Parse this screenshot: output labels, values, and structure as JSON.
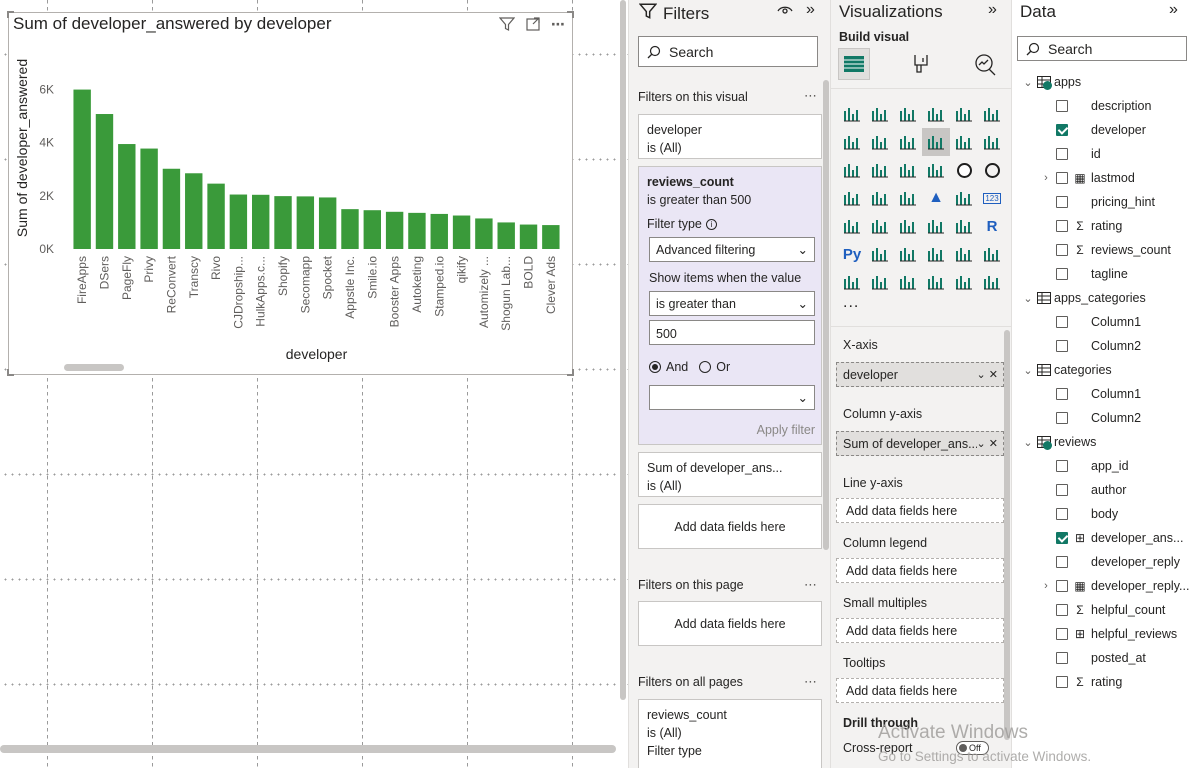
{
  "chart_data": {
    "type": "bar",
    "title": "Sum of developer_answered by developer",
    "xlabel": "developer",
    "ylabel": "Sum of developer_answered",
    "categories": [
      "FireApps",
      "DSers",
      "PageFly",
      "Privy",
      "ReConvert",
      "Transcy",
      "Rivo",
      "CJDropship...",
      "HulkApps.c...",
      "Shopify",
      "Secomapp",
      "Spocket",
      "Appstle Inc.",
      "Smile.io",
      "Booster Apps",
      "Autoketing",
      "Stamped.io",
      "qikify",
      "Automizely ...",
      "Shogun Lab...",
      "BOLD",
      "Clever Ads"
    ],
    "values": [
      6000,
      5080,
      3950,
      3780,
      3020,
      2850,
      2460,
      2050,
      2040,
      1990,
      1980,
      1940,
      1500,
      1460,
      1400,
      1360,
      1320,
      1260,
      1150,
      1000,
      920,
      900
    ],
    "yticks": [
      "0K",
      "2K",
      "4K",
      "6K"
    ],
    "ylim": [
      0,
      7000
    ],
    "color": "#3a9a3a"
  },
  "filters": {
    "title": "Filters",
    "search_placeholder": "Search",
    "on_visual": "Filters on this visual",
    "on_page": "Filters on this page",
    "on_all_pages": "Filters on all pages",
    "card_developer": {
      "name": "developer",
      "state": "is (All)"
    },
    "card_reviews": {
      "name": "reviews_count",
      "state": "is greater than 500",
      "filter_type_label": "Filter type",
      "filter_type_value": "Advanced filtering",
      "show_items_label": "Show items when the value",
      "condition": "is greater than",
      "value": "500",
      "and_label": "And",
      "or_label": "Or",
      "apply": "Apply filter"
    },
    "card_sum": {
      "name": "Sum of developer_ans...",
      "state": "is (All)"
    },
    "add_fields": "Add data fields here",
    "card_all_pages": {
      "name": "reviews_count",
      "state": "is (All)",
      "partial": "Filter type"
    }
  },
  "viz": {
    "title": "Visualizations",
    "build_visual": "Build visual",
    "more": "...",
    "wells": [
      {
        "label": "X-axis",
        "value": "developer"
      },
      {
        "label": "Column y-axis",
        "value": "Sum of developer_ans..."
      },
      {
        "label": "Line y-axis",
        "value": "Add data fields here"
      },
      {
        "label": "Column legend",
        "value": "Add data fields here"
      },
      {
        "label": "Small multiples",
        "value": "Add data fields here"
      },
      {
        "label": "Tooltips",
        "value": "Add data fields here"
      }
    ],
    "drill_through": "Drill through",
    "cross_report": "Cross-report",
    "toggle": "Off"
  },
  "data": {
    "title": "Data",
    "search_placeholder": "Search",
    "tree": [
      {
        "kind": "table",
        "label": "apps",
        "checked": true
      },
      {
        "kind": "field",
        "label": "description",
        "checked": false,
        "icon": ""
      },
      {
        "kind": "field",
        "label": "developer",
        "checked": true,
        "icon": ""
      },
      {
        "kind": "field",
        "label": "id",
        "checked": false,
        "icon": ""
      },
      {
        "kind": "field",
        "label": "lastmod",
        "checked": false,
        "icon": "calendar",
        "expand": true
      },
      {
        "kind": "field",
        "label": "pricing_hint",
        "checked": false,
        "icon": ""
      },
      {
        "kind": "field",
        "label": "rating",
        "checked": false,
        "icon": "sigma"
      },
      {
        "kind": "field",
        "label": "reviews_count",
        "checked": false,
        "icon": "sigma"
      },
      {
        "kind": "field",
        "label": "tagline",
        "checked": false,
        "icon": ""
      },
      {
        "kind": "table",
        "label": "apps_categories",
        "checked": false
      },
      {
        "kind": "field",
        "label": "Column1",
        "checked": false,
        "icon": ""
      },
      {
        "kind": "field",
        "label": "Column2",
        "checked": false,
        "icon": ""
      },
      {
        "kind": "table",
        "label": "categories",
        "checked": false
      },
      {
        "kind": "field",
        "label": "Column1",
        "checked": false,
        "icon": ""
      },
      {
        "kind": "field",
        "label": "Column2",
        "checked": false,
        "icon": ""
      },
      {
        "kind": "table",
        "label": "reviews",
        "checked": true
      },
      {
        "kind": "field",
        "label": "app_id",
        "checked": false,
        "icon": ""
      },
      {
        "kind": "field",
        "label": "author",
        "checked": false,
        "icon": ""
      },
      {
        "kind": "field",
        "label": "body",
        "checked": false,
        "icon": ""
      },
      {
        "kind": "field",
        "label": "developer_ans...",
        "checked": true,
        "icon": "calc"
      },
      {
        "kind": "field",
        "label": "developer_reply",
        "checked": false,
        "icon": ""
      },
      {
        "kind": "field",
        "label": "developer_reply...",
        "checked": false,
        "icon": "calendar",
        "expand": true
      },
      {
        "kind": "field",
        "label": "helpful_count",
        "checked": false,
        "icon": "sigma"
      },
      {
        "kind": "field",
        "label": "helpful_reviews",
        "checked": false,
        "icon": "calc"
      },
      {
        "kind": "field",
        "label": "posted_at",
        "checked": false,
        "icon": ""
      },
      {
        "kind": "field",
        "label": "rating",
        "checked": false,
        "icon": "sigma"
      }
    ]
  },
  "watermark": {
    "line1": "Activate Windows",
    "line2": "Go to Settings to activate Windows."
  }
}
